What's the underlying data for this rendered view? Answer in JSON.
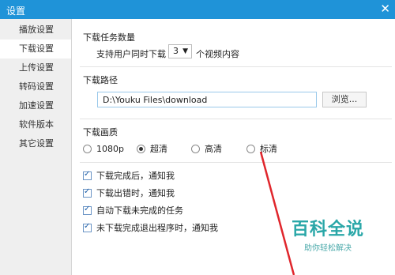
{
  "window": {
    "title": "设置",
    "close_glyph": "✕"
  },
  "sidebar": {
    "items": [
      {
        "label": "播放设置"
      },
      {
        "label": "下载设置"
      },
      {
        "label": "上传设置"
      },
      {
        "label": "转码设置"
      },
      {
        "label": "加速设置"
      },
      {
        "label": "软件版本"
      },
      {
        "label": "其它设置"
      }
    ],
    "active_index": 1
  },
  "download": {
    "task_count": {
      "heading": "下载任务数量",
      "prefix": "支持用户同时下载",
      "value": "3",
      "arrow": "▼",
      "suffix": "个视频内容"
    },
    "path": {
      "heading": "下载路径",
      "value": "D:\\Youku Files\\download",
      "browse_label": "浏览..."
    },
    "quality": {
      "heading": "下载画质",
      "options": [
        {
          "label": "1080p",
          "selected": false
        },
        {
          "label": "超清",
          "selected": true
        },
        {
          "label": "高清",
          "selected": false
        },
        {
          "label": "标清",
          "selected": false
        }
      ]
    },
    "notifications": [
      {
        "label": "下载完成后，通知我",
        "checked": true
      },
      {
        "label": "下载出错时，通知我",
        "checked": true
      },
      {
        "label": "自动下载未完成的任务",
        "checked": true
      },
      {
        "label": "未下载完成退出程序时，通知我",
        "checked": true
      }
    ]
  },
  "watermark": {
    "title": "百科全说",
    "subtitle": "助你轻松解决"
  },
  "colors": {
    "titlebar": "#1f93d8",
    "annotation": "#e0262c",
    "watermark": "#2aa7a8"
  }
}
